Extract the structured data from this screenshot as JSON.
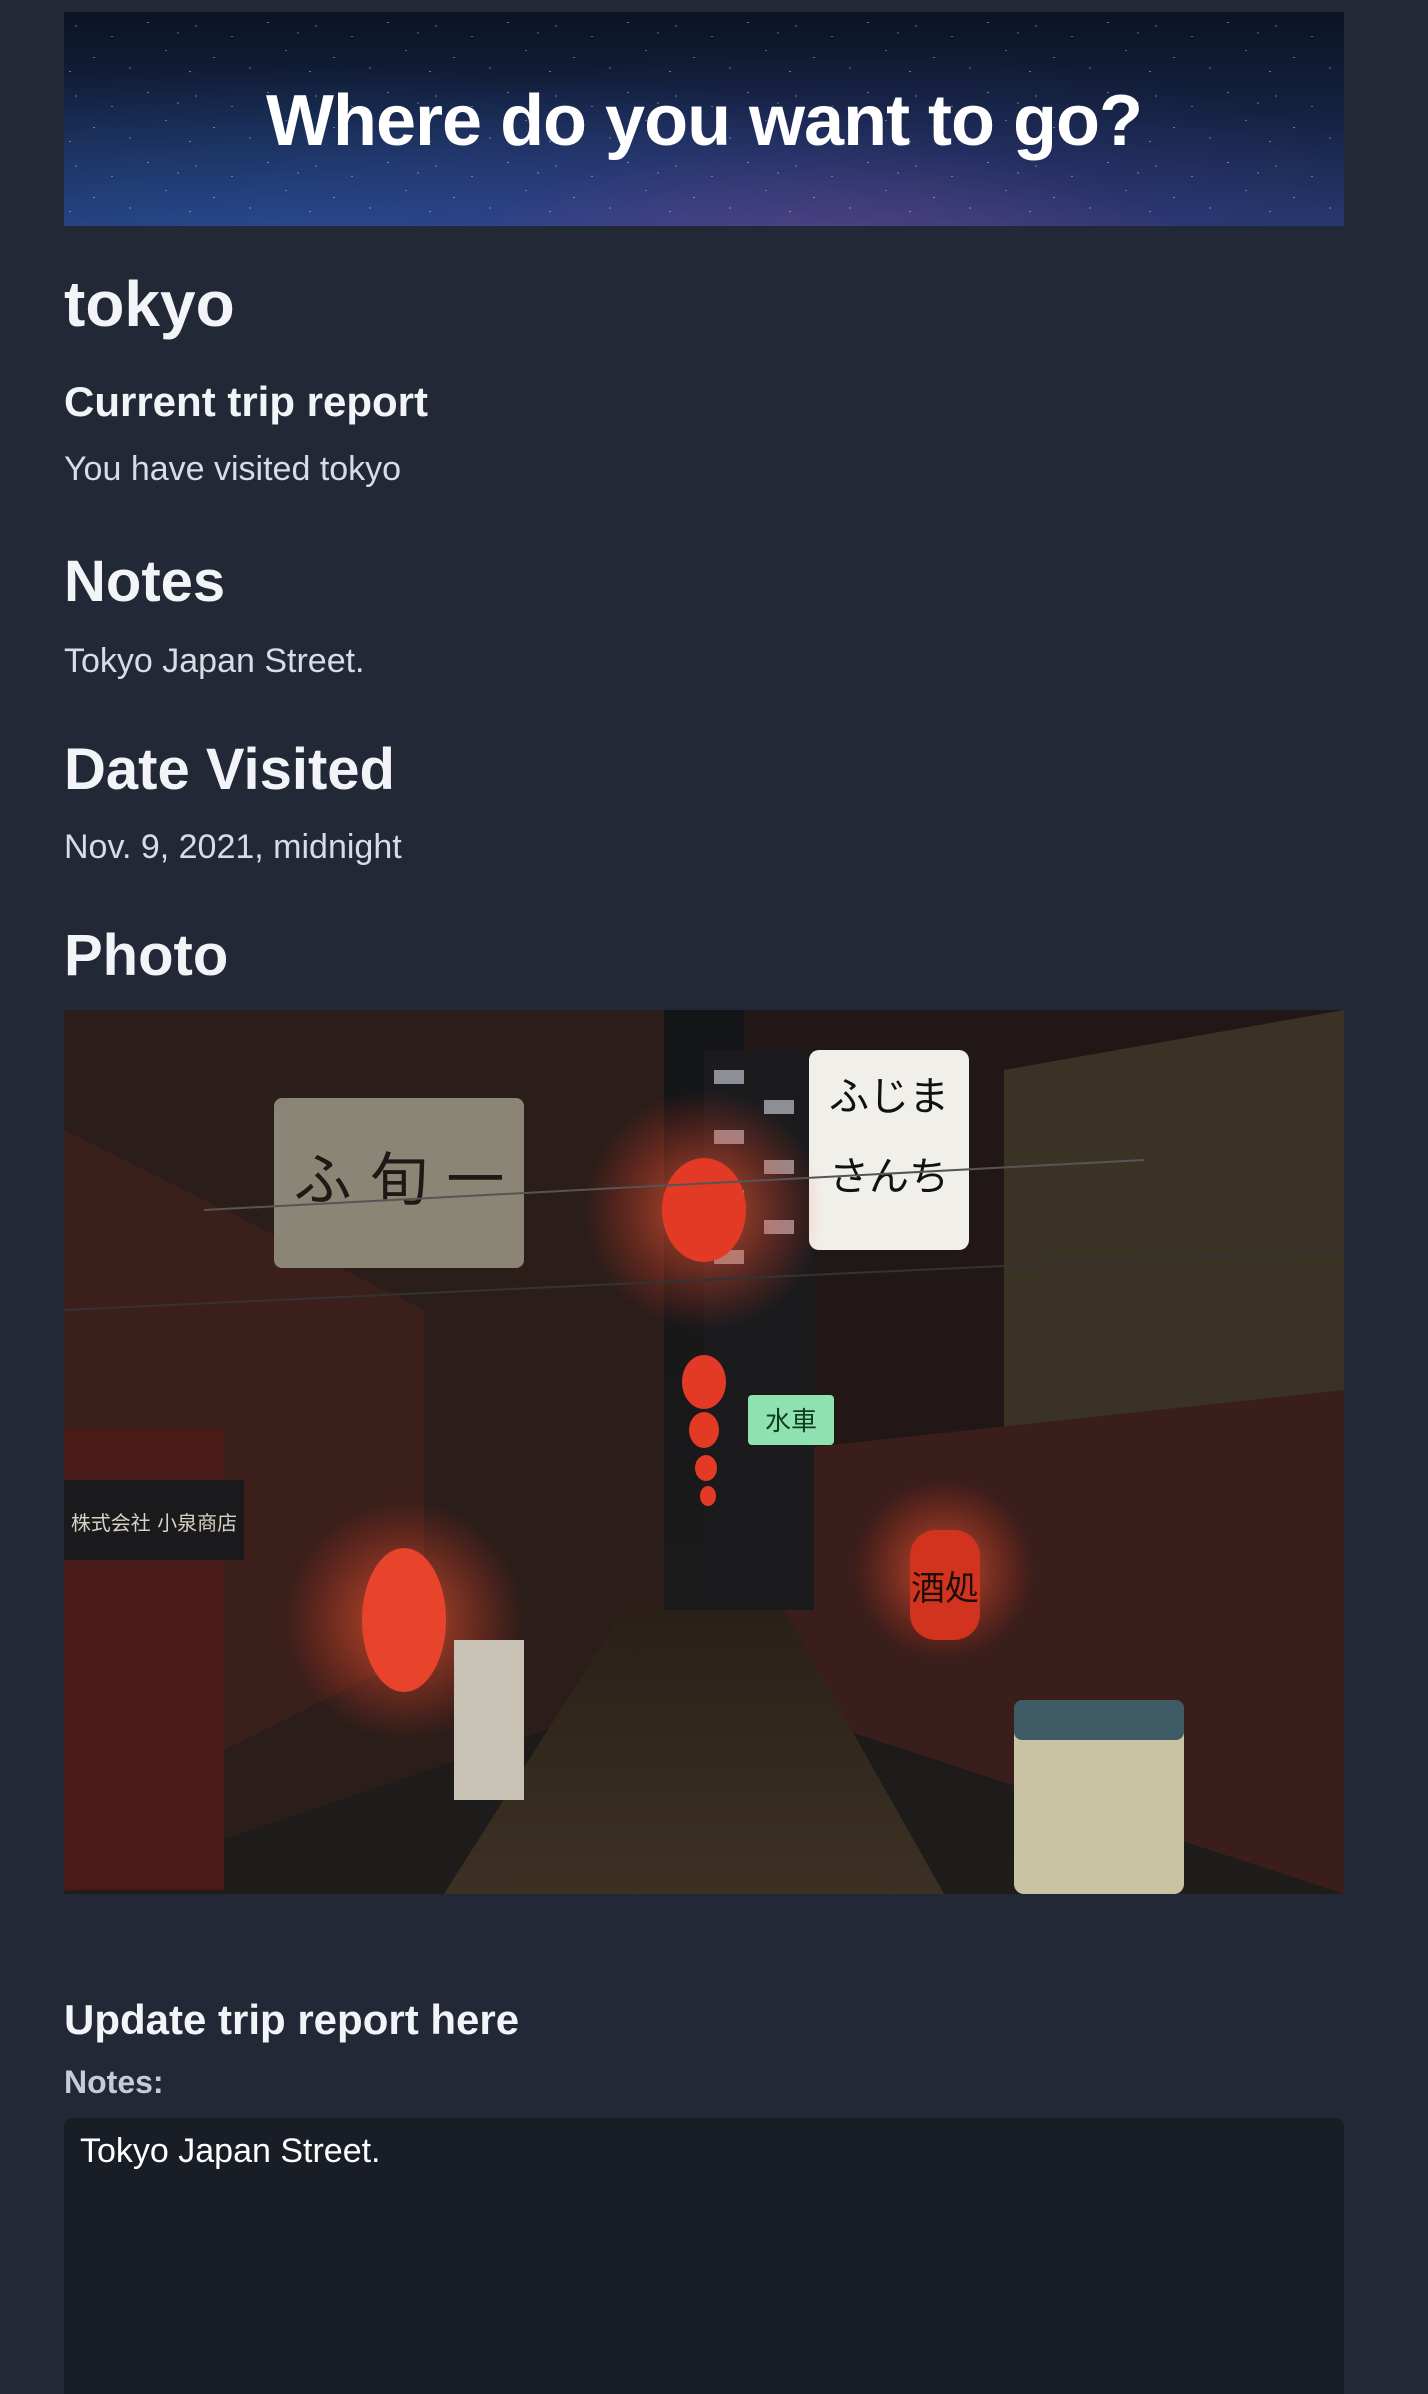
{
  "banner": {
    "heading": "Where do you want to go?"
  },
  "trip": {
    "city": "tokyo",
    "report_heading": "Current trip report",
    "visited_text": "You have visited tokyo",
    "notes_heading": "Notes",
    "notes_text": "Tokyo Japan Street.",
    "date_heading": "Date Visited",
    "date_text": "Nov. 9, 2021, midnight",
    "photo_heading": "Photo"
  },
  "photo": {
    "signs": {
      "left_sign": "ふ 旬 一",
      "right_sign_line1": "ふじま",
      "right_sign_line2": "さんち",
      "green_sign": "水車",
      "lantern_right": "酒処",
      "shop_sign": "株式会社 小泉商店"
    }
  },
  "form": {
    "heading": "Update trip report here",
    "notes_label": "Notes:",
    "notes_value": "Tokyo Japan Street."
  },
  "colors": {
    "background": "#222836",
    "textarea_bg": "#191d26",
    "lantern_red": "#e23a25"
  }
}
